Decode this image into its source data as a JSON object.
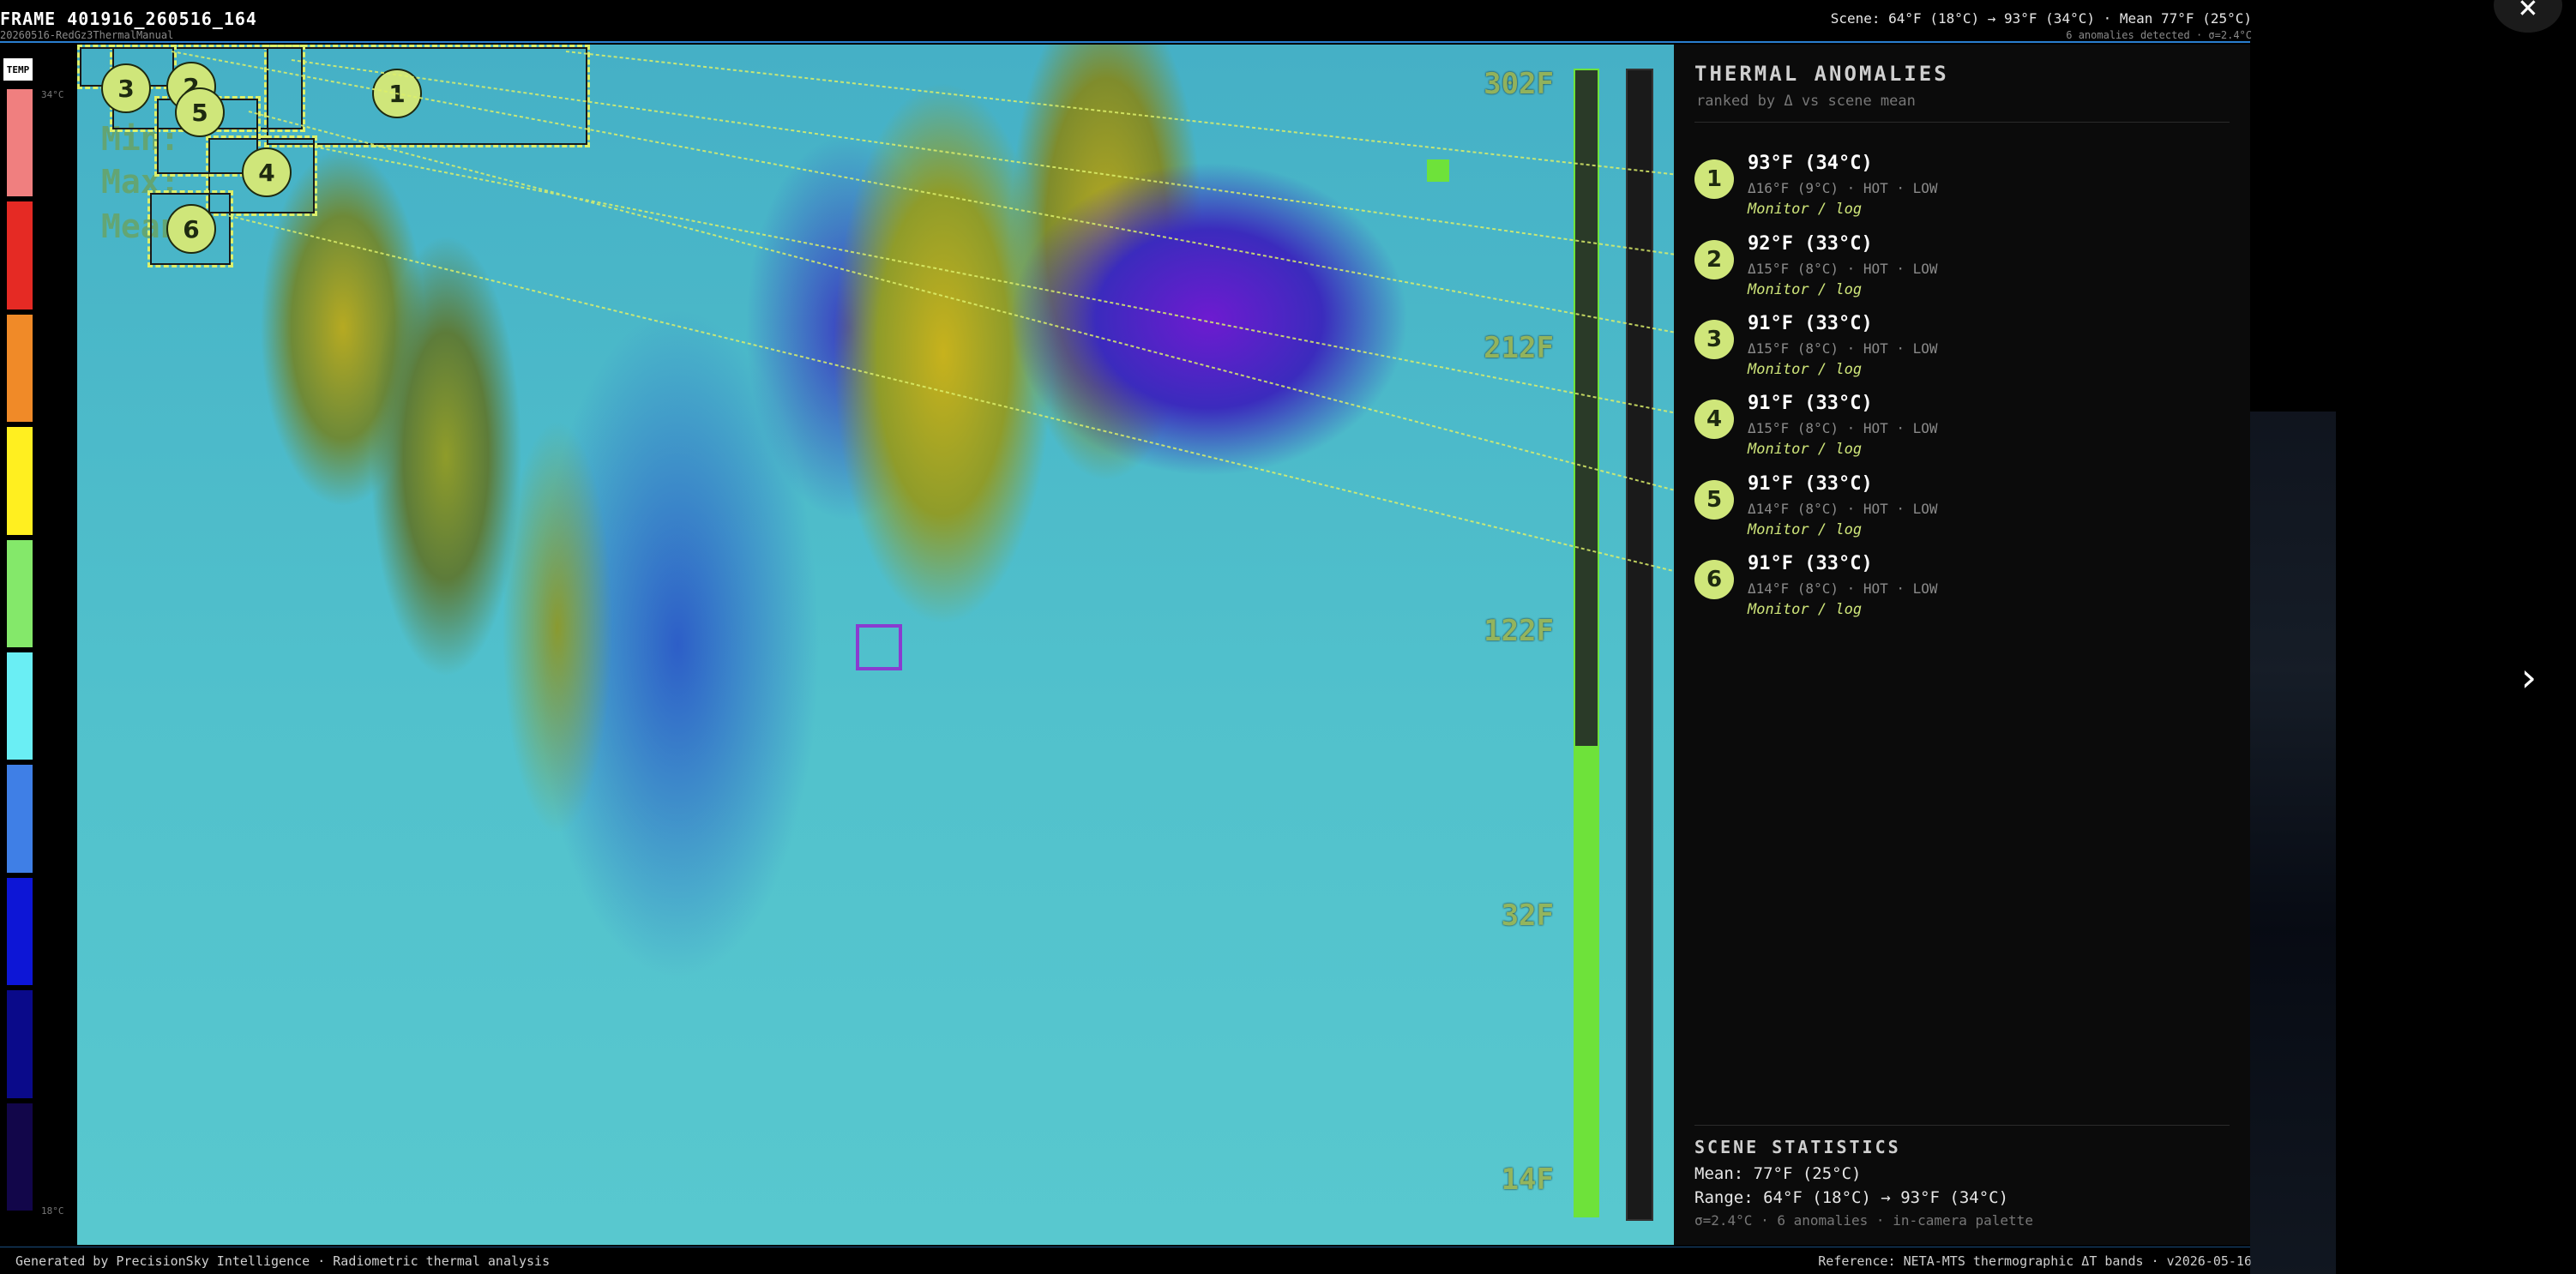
{
  "header": {
    "frame_title": "FRAME 401916_260516_164",
    "frame_sub": "20260516-RedGz3ThermalManual",
    "scene_line": "Scene: 64°F (18°C) → 93°F (34°C) · Mean 77°F (25°C)",
    "anomalies_line": "6 anomalies detected · σ=2.4°C"
  },
  "scale": {
    "chip_label": "TEMP",
    "high_label": "34°C",
    "low_label": "18°C",
    "colors": [
      "#ffffff",
      "#f07f7f",
      "#e52a24",
      "#f08a28",
      "#ffef20",
      "#84e86a",
      "#6aeef4",
      "#3f7fe6",
      "#0d16d6",
      "#0a0a8a",
      "#12064a"
    ]
  },
  "image": {
    "overlay_text": [
      "Min:",
      "Max:",
      "Mean:"
    ],
    "tick_labels": [
      "302F",
      "212F",
      "122F",
      "32F",
      "14F"
    ],
    "temp_bar_fraction": 0.41
  },
  "markers": [
    "1",
    "2",
    "3",
    "4",
    "5",
    "6"
  ],
  "panel": {
    "title": "THERMAL ANOMALIES",
    "subtitle": "ranked by Δ vs scene mean",
    "items": [
      {
        "num": "1",
        "temp": "93°F (34°C)",
        "delta": "Δ16°F (9°C) · HOT · LOW",
        "action": "Monitor / log"
      },
      {
        "num": "2",
        "temp": "92°F (33°C)",
        "delta": "Δ15°F (8°C) · HOT · LOW",
        "action": "Monitor / log"
      },
      {
        "num": "3",
        "temp": "91°F (33°C)",
        "delta": "Δ15°F (8°C) · HOT · LOW",
        "action": "Monitor / log"
      },
      {
        "num": "4",
        "temp": "91°F (33°C)",
        "delta": "Δ15°F (8°C) · HOT · LOW",
        "action": "Monitor / log"
      },
      {
        "num": "5",
        "temp": "91°F (33°C)",
        "delta": "Δ14°F (8°C) · HOT · LOW",
        "action": "Monitor / log"
      },
      {
        "num": "6",
        "temp": "91°F (33°C)",
        "delta": "Δ14°F (8°C) · HOT · LOW",
        "action": "Monitor / log"
      }
    ],
    "stats_title": "SCENE STATISTICS",
    "stats_mean": "Mean: 77°F (25°C)",
    "stats_range": "Range: 64°F (18°C) → 93°F (34°C)",
    "stats_extra": "σ=2.4°C · 6 anomalies · in-camera palette"
  },
  "footer": {
    "left": "Generated by PrecisionSky Intelligence · Radiometric thermal analysis",
    "right": "Reference: NETA-MTS thermographic ΔT bands · v2026-05-16"
  },
  "controls": {
    "close_glyph": "×",
    "next_glyph": "›"
  }
}
